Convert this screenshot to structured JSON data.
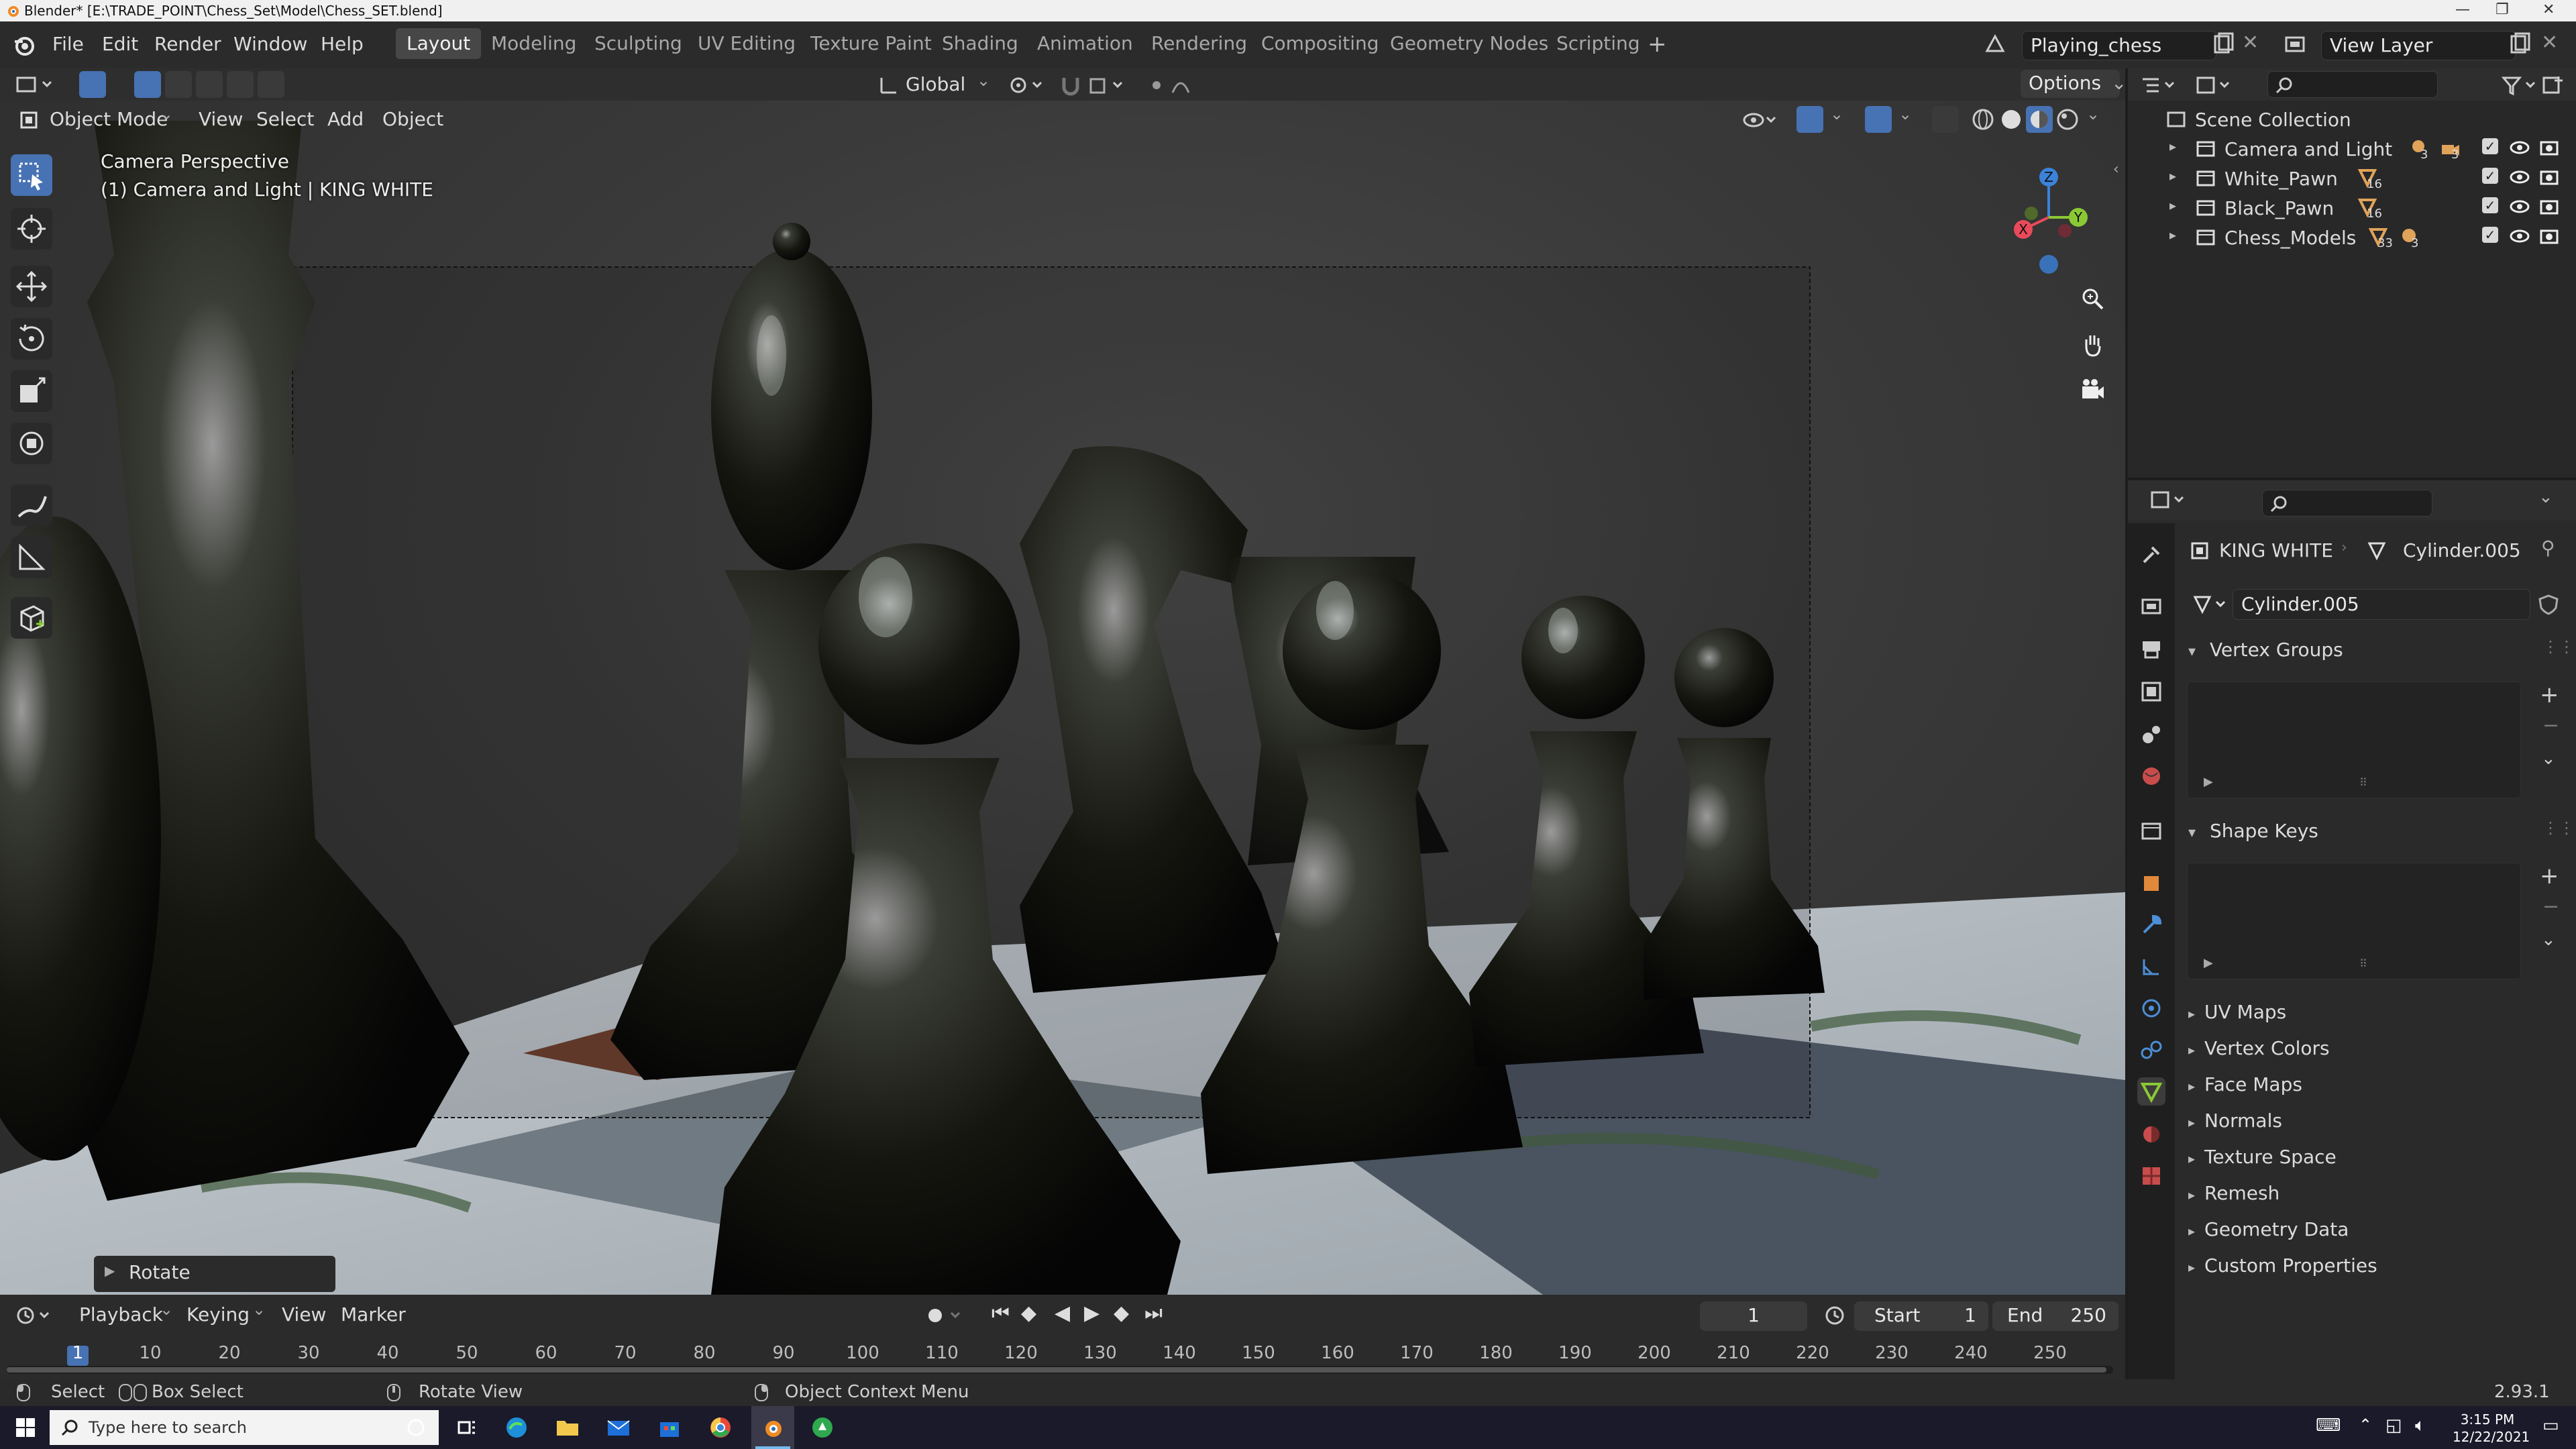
{
  "window": {
    "title": "Blender* [E:\\TRADE_POINT\\Chess_Set\\Model\\Chess_SET.blend]"
  },
  "menubar": {
    "items": [
      "File",
      "Edit",
      "Render",
      "Window",
      "Help"
    ]
  },
  "workspaces": {
    "tabs": [
      "Layout",
      "Modeling",
      "Sculpting",
      "UV Editing",
      "Texture Paint",
      "Shading",
      "Animation",
      "Rendering",
      "Compositing",
      "Geometry Nodes",
      "Scripting"
    ],
    "active": "Layout"
  },
  "scene": {
    "name": "Playing_chess",
    "view_layer": "View Layer"
  },
  "tool_header": {
    "orientation": "Global",
    "options_label": "Options"
  },
  "viewport_header": {
    "mode": "Object Mode",
    "menus": [
      "View",
      "Select",
      "Add",
      "Object"
    ]
  },
  "viewport": {
    "view_name": "Camera Perspective",
    "object_info": "(1) Camera and Light | KING WHITE",
    "last_operator": "Rotate",
    "gizmo_axes": {
      "z": "Z",
      "x": "X",
      "y": "Y"
    }
  },
  "outliner": {
    "root": "Scene Collection",
    "collections": [
      {
        "name": "Camera and Light",
        "badges": [
          "3",
          "3"
        ]
      },
      {
        "name": "White_Pawn",
        "badges": [
          "16"
        ]
      },
      {
        "name": "Black_Pawn",
        "badges": [
          "16"
        ]
      },
      {
        "name": "Chess_Models",
        "badges": [
          "33",
          "3"
        ]
      }
    ]
  },
  "properties": {
    "object_name": "KING WHITE",
    "data_name": "Cylinder.005",
    "mesh_field": "Cylinder.005",
    "panels_open": [
      "Vertex Groups",
      "Shape Keys"
    ],
    "panels_closed": [
      "UV Maps",
      "Vertex Colors",
      "Face Maps",
      "Normals",
      "Texture Space",
      "Remesh",
      "Geometry Data",
      "Custom Properties"
    ]
  },
  "timeline": {
    "menus": [
      "Playback",
      "Keying",
      "View",
      "Marker"
    ],
    "current_frame": "1",
    "start_label": "Start",
    "start": "1",
    "end_label": "End",
    "end": "250",
    "ticks": [
      "1",
      "10",
      "20",
      "30",
      "40",
      "50",
      "60",
      "70",
      "80",
      "90",
      "100",
      "110",
      "120",
      "130",
      "140",
      "150",
      "160",
      "170",
      "180",
      "190",
      "200",
      "210",
      "220",
      "230",
      "240",
      "250"
    ]
  },
  "statusbar": {
    "select": "Select",
    "box_select": "Box Select",
    "rotate_view": "Rotate View",
    "context_menu": "Object Context Menu",
    "version": "2.93.1"
  },
  "taskbar": {
    "search_placeholder": "Type here to search",
    "time": "3:15 PM",
    "date": "12/22/2021"
  },
  "colors": {
    "accent": "#4772b3",
    "x_axis": "#e84a5a",
    "y_axis": "#8ac934",
    "z_axis": "#3b82d9"
  }
}
